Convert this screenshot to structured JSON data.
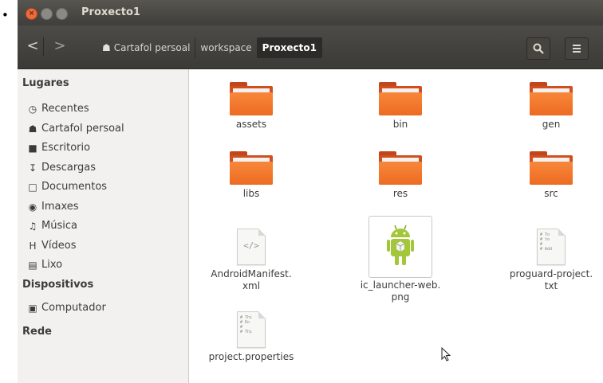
{
  "window": {
    "title": "Proxecto1"
  },
  "nav": {
    "back_glyph": "<",
    "forward_glyph": ">",
    "breadcrumbs": [
      {
        "label": "Cartafol persoal",
        "icon": "home-icon"
      },
      {
        "label": "workspace"
      },
      {
        "label": "Proxecto1",
        "active": true
      }
    ],
    "search_icon": "search-icon",
    "menu_icon": "menu-icon"
  },
  "sidebar": {
    "places_heading": "Lugares",
    "places": [
      {
        "label": "Recentes",
        "icon": "clock-icon"
      },
      {
        "label": "Cartafol persoal",
        "icon": "home-icon"
      },
      {
        "label": "Escritorio",
        "icon": "desktop-icon"
      },
      {
        "label": "Descargas",
        "icon": "download-icon"
      },
      {
        "label": "Documentos",
        "icon": "document-icon"
      },
      {
        "label": "Imaxes",
        "icon": "camera-icon"
      },
      {
        "label": "Música",
        "icon": "music-icon"
      },
      {
        "label": "Vídeos",
        "icon": "film-icon"
      },
      {
        "label": "Lixo",
        "icon": "trash-icon"
      }
    ],
    "devices_heading": "Dispositivos",
    "devices": [
      {
        "label": "Computador",
        "icon": "computer-icon"
      }
    ],
    "network_heading": "Rede"
  },
  "files": [
    {
      "name": "assets",
      "type": "folder"
    },
    {
      "name": "bin",
      "type": "folder"
    },
    {
      "name": "gen",
      "type": "folder"
    },
    {
      "name": "libs",
      "type": "folder"
    },
    {
      "name": "res",
      "type": "folder"
    },
    {
      "name": "src",
      "type": "folder"
    },
    {
      "name": "AndroidManifest.\nxml",
      "type": "xml"
    },
    {
      "name": "ic_launcher-web.\npng",
      "type": "image",
      "selected": true
    },
    {
      "name": "proguard-project.\ntxt",
      "type": "text"
    },
    {
      "name": "project.properties",
      "type": "text"
    }
  ],
  "colors": {
    "accent_folder": "#ed6b22",
    "titlebar": "#3f3e3a",
    "android_green": "#a4c639"
  }
}
